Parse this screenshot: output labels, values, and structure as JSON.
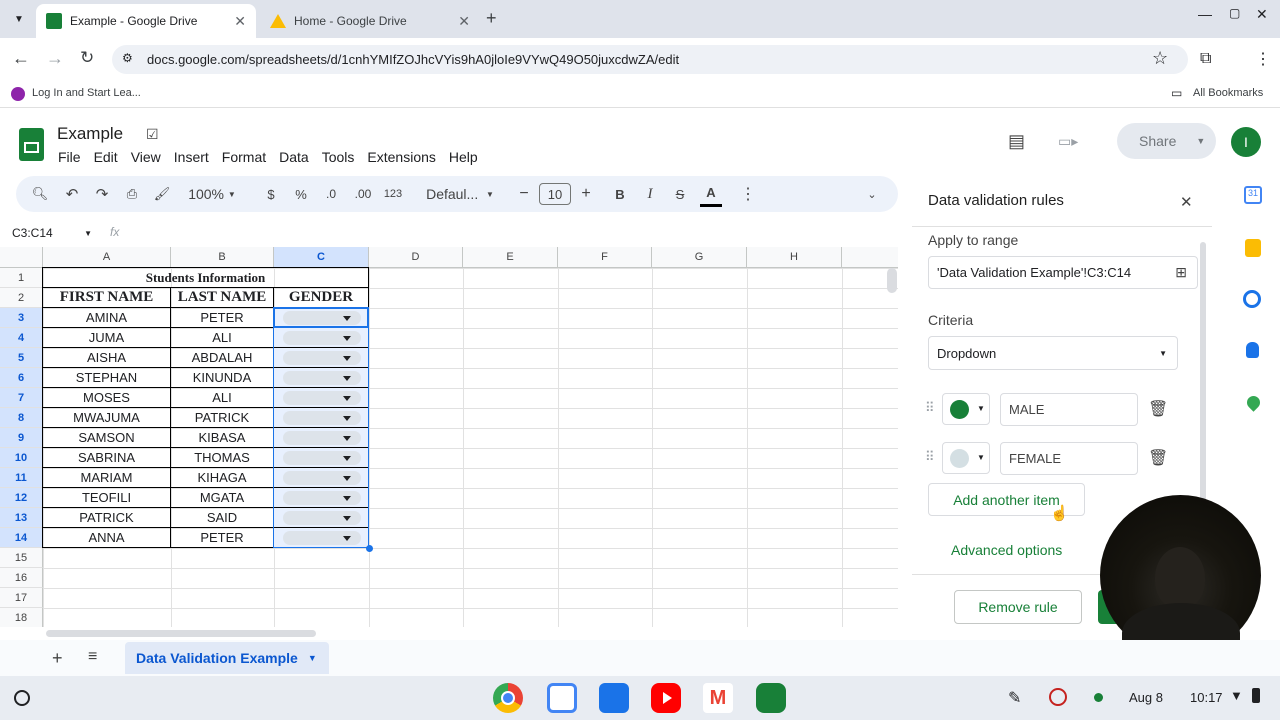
{
  "browser": {
    "tabs": [
      {
        "title": "Example - Google Drive",
        "active": true
      },
      {
        "title": "Home - Google Drive",
        "active": false
      }
    ],
    "url": "docs.google.com/spreadsheets/d/1cnhYMIfZOJhcVYis9hA0jloIe9VYwQ49O50juxcdwZA/edit",
    "bookmarks": {
      "item": "Log In and Start Lea...",
      "all": "All Bookmarks"
    }
  },
  "sheets": {
    "doc_title": "Example",
    "menu": [
      "File",
      "Edit",
      "View",
      "Insert",
      "Format",
      "Data",
      "Tools",
      "Extensions",
      "Help"
    ],
    "share_label": "Share",
    "account_initial": "I",
    "toolbar": {
      "zoom": "100%",
      "currency": "$",
      "percent": "%",
      "dec_decrease": ".0",
      "dec_increase": ".00",
      "number_format": "123",
      "font": "Defaul...",
      "font_size": "10",
      "bold": "B",
      "italic": "I"
    },
    "name_box": "C3:C14",
    "fx": "fx",
    "columns": [
      "A",
      "B",
      "C",
      "D",
      "E",
      "F",
      "G",
      "H"
    ],
    "rows": [
      "1",
      "2",
      "3",
      "4",
      "5",
      "6",
      "7",
      "8",
      "9",
      "10",
      "11",
      "12",
      "13",
      "14",
      "15",
      "16",
      "17",
      "18"
    ],
    "table": {
      "title": "Students Information",
      "headers": [
        "FIRST NAME",
        "LAST NAME",
        "GENDER"
      ],
      "data": [
        [
          "AMINA",
          "PETER"
        ],
        [
          "JUMA",
          "ALI"
        ],
        [
          "AISHA",
          "ABDALAH"
        ],
        [
          "STEPHAN",
          "KINUNDA"
        ],
        [
          "MOSES",
          "ALI"
        ],
        [
          "MWAJUMA",
          "PATRICK"
        ],
        [
          "SAMSON",
          "KIBASA"
        ],
        [
          "SABRINA",
          "THOMAS"
        ],
        [
          "MARIAM",
          "KIHAGA"
        ],
        [
          "TEOFILI",
          "MGATA"
        ],
        [
          "PATRICK",
          "SAID"
        ],
        [
          "ANNA",
          "PETER"
        ]
      ]
    },
    "sheet_tab": "Data Validation Example"
  },
  "panel": {
    "title": "Data validation rules",
    "apply_label": "Apply to range",
    "range": "'Data Validation Example'!C3:C14",
    "criteria_label": "Criteria",
    "criteria_value": "Dropdown",
    "items": [
      {
        "value": "MALE",
        "color": "#188038"
      },
      {
        "value": "FEMALE",
        "color": "#d4dfe3"
      }
    ],
    "add_item": "Add another item",
    "advanced": "Advanced options",
    "remove_rule": "Remove rule"
  },
  "shelf": {
    "date": "Aug 8",
    "time": "10:17",
    "calendar_day": "31"
  },
  "colors": {
    "accent": "#0b57d0",
    "green": "#188038",
    "selection": "#d3e3fd"
  }
}
